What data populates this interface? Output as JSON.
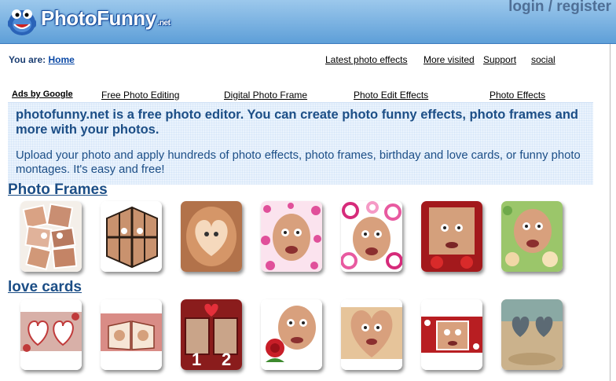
{
  "header": {
    "logo_text": "PhotoFunny",
    "logo_suffix": ".net",
    "login_label": "login / register"
  },
  "breadcrumb": {
    "prefix": "You are:",
    "home_label": "Home"
  },
  "top_links": [
    "Latest photo effects",
    "More visited",
    "Support",
    "social"
  ],
  "ads": {
    "label": "Ads by Google",
    "links": [
      "Free Photo Editing",
      "Digital Photo Frame",
      "Photo Edit Effects",
      "Photo Effects"
    ]
  },
  "intro": {
    "headline": "photofunny.net is a free photo editor. You can create photo funny effects, photo frames and more with your photos.",
    "body": "Upload your photo and apply hundreds of photo effects, photo frames, birthday and love cards, or funny photo montages. It's easy and free!"
  },
  "sections": [
    {
      "title": "Photo Frames",
      "thumbs": [
        "puzzle-face-thumb",
        "cube-face-thumb",
        "heart-hands-thumb",
        "hearts-frame-thumb",
        "circles-frame-thumb",
        "red-frame-thumb",
        "green-flowers-thumb"
      ]
    },
    {
      "title": "love cards",
      "thumbs": [
        "snow-hearts-thumb",
        "heart-book-thumb",
        "heart-12-thumb",
        "red-rose-thumb",
        "heart-cutout-thumb",
        "red-card-thumb",
        "sand-hearts-thumb"
      ]
    }
  ],
  "colors": {
    "header_top": "#9cc8ec",
    "header_bottom": "#5e9fd8",
    "text_blue": "#1c4e86",
    "info_bg": "#eaf3fd"
  }
}
